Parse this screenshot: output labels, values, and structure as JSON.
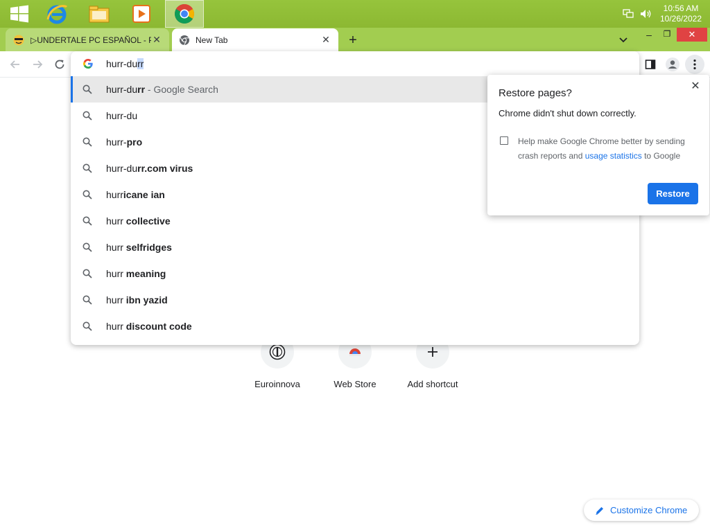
{
  "taskbar": {
    "apps": [
      {
        "name": "windows-start",
        "icon": "windows-logo-icon"
      },
      {
        "name": "internet-explorer",
        "icon": "ie-icon"
      },
      {
        "name": "file-explorer",
        "icon": "folder-icon"
      },
      {
        "name": "media-player",
        "icon": "media-player-icon"
      },
      {
        "name": "chrome",
        "icon": "chrome-icon",
        "active": true
      }
    ],
    "clock": {
      "time": "10:56 AM",
      "date": "10/26/2022"
    }
  },
  "tabs": {
    "items": [
      {
        "title": "▷UNDERTALE PC ESPAÑOL - Piv",
        "active": false
      },
      {
        "title": "New Tab",
        "active": true
      }
    ],
    "new_tab_label": "+",
    "window": {
      "minimize": "–",
      "maximize": "❐",
      "close": "✕"
    }
  },
  "omnibox": {
    "typed": "hurr-du",
    "selected": "rr",
    "suggestions": [
      {
        "prefix": "hurr-du",
        "bold": "rr",
        "suffix": " - Google Search",
        "highlight": true
      },
      {
        "prefix": "hurr-du",
        "bold": "",
        "suffix": ""
      },
      {
        "prefix": "hurr-",
        "bold": "pro",
        "suffix": ""
      },
      {
        "prefix": "hurr-du",
        "bold": "rr.com virus",
        "suffix": ""
      },
      {
        "prefix": "hurr",
        "bold": "icane ian",
        "suffix": ""
      },
      {
        "prefix": "hurr ",
        "bold": "collective",
        "suffix": ""
      },
      {
        "prefix": "hurr ",
        "bold": "selfridges",
        "suffix": ""
      },
      {
        "prefix": "hurr ",
        "bold": "meaning",
        "suffix": ""
      },
      {
        "prefix": "hurr ",
        "bold": "ibn yazid",
        "suffix": ""
      },
      {
        "prefix": "hurr ",
        "bold": "discount code",
        "suffix": ""
      }
    ]
  },
  "shortcuts": [
    {
      "label": "Euroinnova",
      "icon": "euroinnova-icon"
    },
    {
      "label": "Web Store",
      "icon": "web-store-icon"
    },
    {
      "label": "Add shortcut",
      "icon": "plus-icon"
    }
  ],
  "restore": {
    "title": "Restore pages?",
    "message": "Chrome didn't shut down correctly.",
    "help_before": "Help make Google Chrome better by sending crash reports and ",
    "help_link": "usage statistics",
    "help_after": " to Google",
    "button": "Restore",
    "close": "✕"
  },
  "customize": {
    "label": "Customize Chrome"
  },
  "colors": {
    "accent": "#1a73e8",
    "frame": "#a2cd50",
    "taskbar": "#8cb832",
    "close_red": "#e04343"
  }
}
